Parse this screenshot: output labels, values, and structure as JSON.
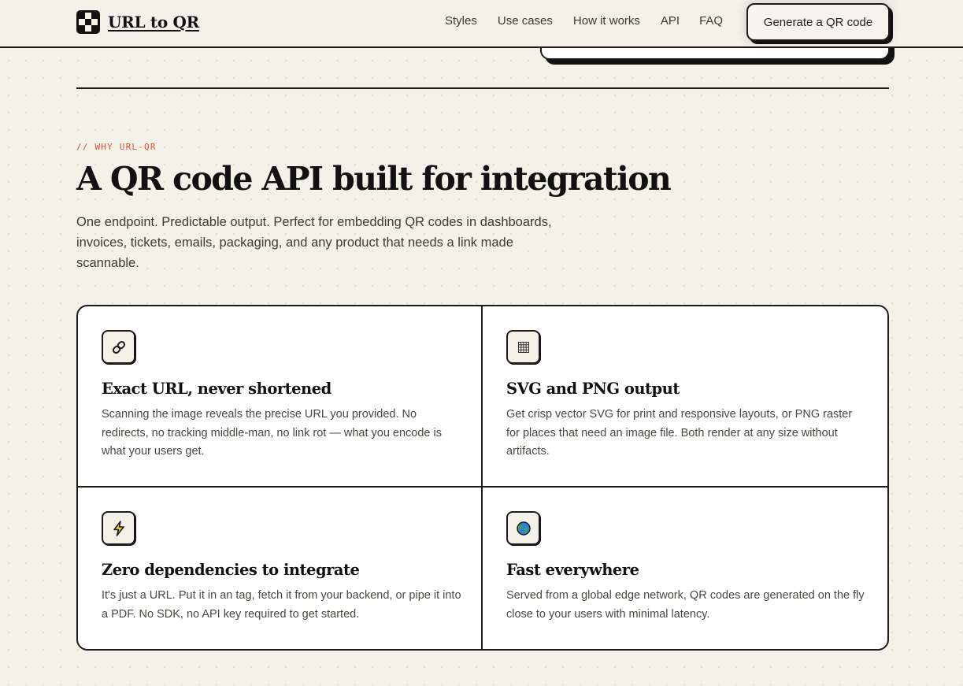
{
  "header": {
    "brand": "URL to QR",
    "nav": [
      "Styles",
      "Use cases",
      "How it works",
      "API",
      "FAQ"
    ],
    "cta": "Generate a QR code"
  },
  "section": {
    "eyebrow": "// WHY URL-QR",
    "title": "A QR code API built for integration",
    "lede": "One endpoint. Predictable output. Perfect for embedding QR codes in dashboards, invoices, tickets, emails, packaging, and any product that needs a link made scannable."
  },
  "features": [
    {
      "icon": "link-icon",
      "title": "Exact URL, never shortened",
      "body": "Scanning the image reveals the precise URL you provided. No redirects, no tracking middle-man, no link rot — what you encode is what your users get."
    },
    {
      "icon": "grid-icon",
      "title": "SVG and PNG output",
      "body": "Get crisp vector SVG for print and responsive layouts, or PNG raster for places that need an image file. Both render at any size without artifacts."
    },
    {
      "icon": "lightning-icon",
      "title": "Zero dependencies to integrate",
      "body": "It's just a URL. Put it in an  tag, fetch it from your backend, or pipe it into a PDF. No SDK, no API key required to get started."
    },
    {
      "icon": "globe-icon",
      "title": "Fast everywhere",
      "body": "Served from a global edge network, QR codes are generated on the fly close to your users with minimal latency."
    }
  ],
  "colors": {
    "background": "#f4f1e9",
    "ink": "#1d1b18",
    "accent": "#e2503a",
    "card": "#ffffff",
    "lightning": "#f2c94c"
  }
}
